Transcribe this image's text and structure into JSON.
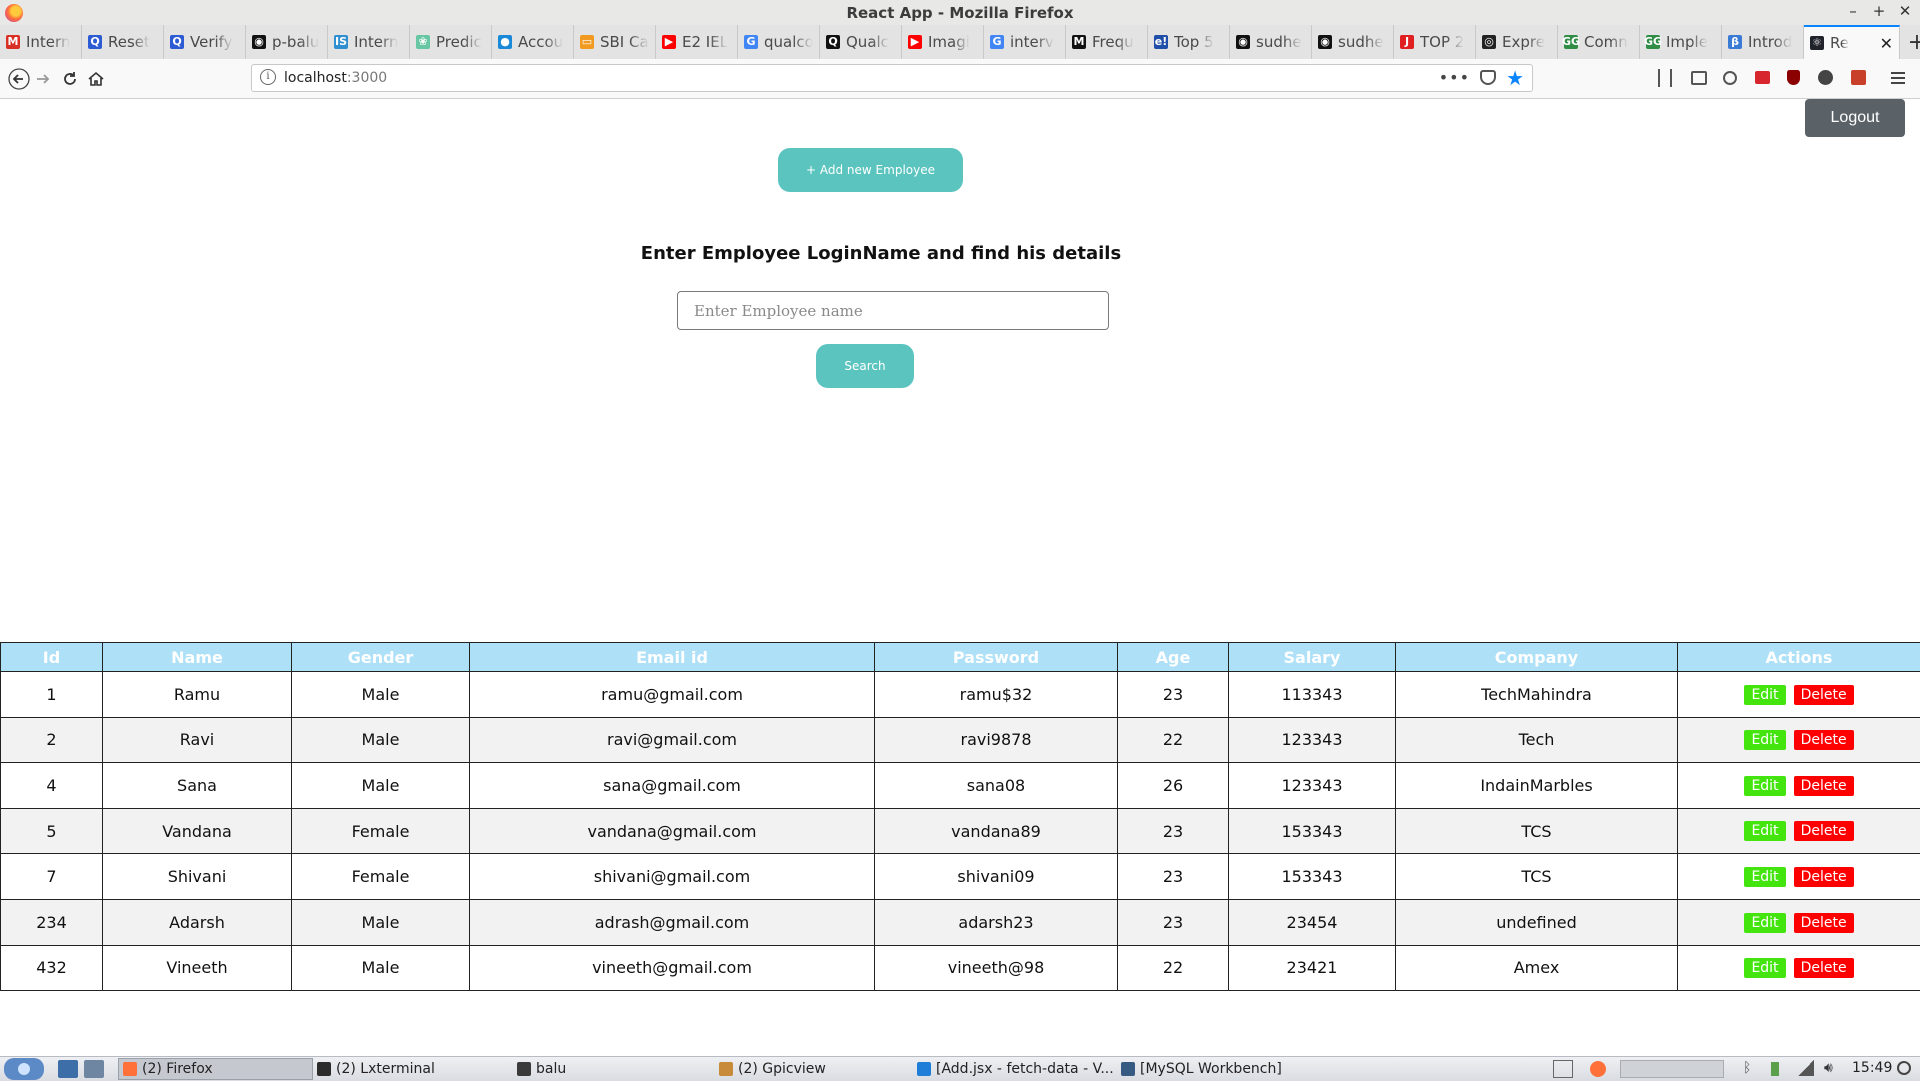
{
  "window": {
    "title": "React App - Mozilla Firefox",
    "controls": [
      "–",
      "+",
      "✕"
    ]
  },
  "tabs": [
    {
      "label": "Intern",
      "icon": "gmail-icon",
      "color": "#d93025",
      "glyph": "M"
    },
    {
      "label": "Reset",
      "icon": "quora-icon",
      "color": "#2d5bd3",
      "glyph": "Q"
    },
    {
      "label": "Verify",
      "icon": "quora-icon",
      "color": "#2d5bd3",
      "glyph": "Q"
    },
    {
      "label": "p-balu",
      "icon": "github-icon",
      "color": "#111111",
      "glyph": "◉"
    },
    {
      "label": "Intern",
      "icon": "internshala-icon",
      "color": "#2f8fd0",
      "glyph": "IS"
    },
    {
      "label": "Predic",
      "icon": "brain-icon",
      "color": "#67c7a5",
      "glyph": "❀"
    },
    {
      "label": "Accou",
      "icon": "account-icon",
      "color": "#1a8ad8",
      "glyph": "●"
    },
    {
      "label": "SBI Ca",
      "icon": "sbi-icon",
      "color": "#f29a1f",
      "glyph": "▭"
    },
    {
      "label": "E2 IEL",
      "icon": "youtube-icon",
      "color": "#ff0000",
      "glyph": "▶"
    },
    {
      "label": "qualco",
      "icon": "google-icon",
      "color": "#4285f4",
      "glyph": "G"
    },
    {
      "label": "Qualc",
      "icon": "qualcomm-icon",
      "color": "#111111",
      "glyph": "Q"
    },
    {
      "label": "Imagi",
      "icon": "youtube-icon",
      "color": "#ff0000",
      "glyph": "▶"
    },
    {
      "label": "interv",
      "icon": "google-icon",
      "color": "#4285f4",
      "glyph": "G"
    },
    {
      "label": "Frequ",
      "icon": "medium-icon",
      "color": "#111111",
      "glyph": "M"
    },
    {
      "label": "Top 5",
      "icon": "edureka-icon",
      "color": "#1f4fa8",
      "glyph": "e!"
    },
    {
      "label": "sudhe",
      "icon": "github-icon",
      "color": "#111111",
      "glyph": "◉"
    },
    {
      "label": "sudhe",
      "icon": "github-icon",
      "color": "#111111",
      "glyph": "◉"
    },
    {
      "label": "TOP 2",
      "icon": "job-icon",
      "color": "#e02020",
      "glyph": "J"
    },
    {
      "label": "Expre",
      "icon": "express-icon",
      "color": "#222222",
      "glyph": "◎"
    },
    {
      "label": "Comn",
      "icon": "gfg-icon",
      "color": "#2f8d46",
      "glyph": "GG"
    },
    {
      "label": "Imple",
      "icon": "gfg-icon",
      "color": "#2f8d46",
      "glyph": "GG"
    },
    {
      "label": "Introd",
      "icon": "beta-icon",
      "color": "#3a7bd5",
      "glyph": "β"
    },
    {
      "label": "Re",
      "icon": "react-icon",
      "color": "#20232a",
      "glyph": "⚛",
      "active": true
    }
  ],
  "navbar": {
    "url_host": "localhost",
    "url_port": ":3000",
    "icons": [
      "back-icon",
      "forward-icon",
      "reload-icon",
      "home-icon",
      "site-info-icon",
      "page-actions-icon",
      "pocket-icon",
      "bookmark-star-icon",
      "library-icon",
      "sidebar-icon",
      "account-icon",
      "extension-icon",
      "ublock-icon",
      "extension-icon",
      "extension-icon",
      "hamburger-menu-icon"
    ]
  },
  "app": {
    "logout_label": "Logout",
    "add_label": "+ Add new Employee",
    "heading": "Enter Employee LoginName and find his details",
    "search_placeholder": "Enter Employee name",
    "search_value": "",
    "search_label": "Search"
  },
  "table": {
    "headers": [
      "Id",
      "Name",
      "Gender",
      "Email id",
      "Password",
      "Age",
      "Salary",
      "Company",
      "Actions"
    ],
    "edit_label": "Edit",
    "delete_label": "Delete",
    "rows": [
      [
        "1",
        "Ramu",
        "Male",
        "ramu@gmail.com",
        "ramu$32",
        "23",
        "113343",
        "TechMahindra"
      ],
      [
        "2",
        "Ravi",
        "Male",
        "ravi@gmail.com",
        "ravi9878",
        "22",
        "123343",
        "Tech"
      ],
      [
        "4",
        "Sana",
        "Male",
        "sana@gmail.com",
        "sana08",
        "26",
        "123343",
        "IndainMarbles"
      ],
      [
        "5",
        "Vandana",
        "Female",
        "vandana@gmail.com",
        "vandana89",
        "23",
        "153343",
        "TCS"
      ],
      [
        "7",
        "Shivani",
        "Female",
        "shivani@gmail.com",
        "shivani09",
        "23",
        "153343",
        "TCS"
      ],
      [
        "234",
        "Adarsh",
        "Male",
        "adrash@gmail.com",
        "adarsh23",
        "23",
        "23454",
        "undefined"
      ],
      [
        "432",
        "Vineeth",
        "Male",
        "vineeth@gmail.com",
        "vineeth@98",
        "22",
        "23421",
        "Amex"
      ]
    ]
  },
  "taskbar": {
    "tasks": [
      {
        "label": "(2) Firefox",
        "icon": "firefox-icon",
        "color": "#ff7139",
        "active": true
      },
      {
        "label": "(2) Lxterminal",
        "icon": "terminal-icon",
        "color": "#2b2b2b"
      },
      {
        "label": "balu",
        "icon": "folder-icon",
        "color": "#3a3a3a"
      },
      {
        "label": "(2) Gpicview",
        "icon": "image-viewer-icon",
        "color": "#c88b3a"
      },
      {
        "label": "[Add.jsx - fetch-data - V...",
        "icon": "vscode-icon",
        "color": "#1f7fd8"
      },
      {
        "label": "[MySQL Workbench]",
        "icon": "mysql-workbench-icon",
        "color": "#365a82"
      }
    ],
    "clock": "15:49"
  }
}
